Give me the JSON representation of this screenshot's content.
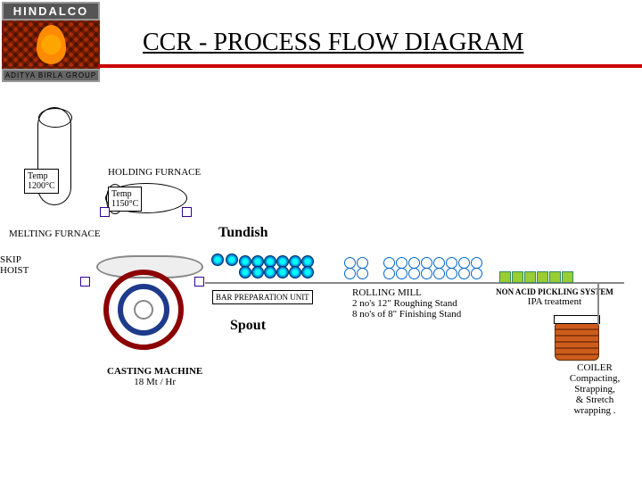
{
  "logo": {
    "brand": "HINDALCO",
    "group": "ADITYA BIRLA GROUP"
  },
  "title": "CCR - PROCESS FLOW DIAGRAM",
  "mf": {
    "label": "MELTING FURNACE",
    "temp_label": "Temp\n1200°C"
  },
  "hf": {
    "label": "HOLDING FURNACE",
    "temp_label": "Temp\n1150°C"
  },
  "tundish": "Tundish",
  "skiphoist": "SKIP\nHOIST",
  "bar_prep": "BAR PREPARATION UNIT",
  "spout": "Spout",
  "casting": {
    "label": "CASTING MACHINE",
    "rate": "18 Mt / Hr"
  },
  "rolling": {
    "title": "ROLLING MILL",
    "l1": "2 no's 12\" Roughing Stand",
    "l2": "8 no's of 8\" Finishing Stand"
  },
  "pickling": {
    "title": "NON ACID PICKLING SYSTEM",
    "sub": "IPA treatment"
  },
  "coiler": {
    "title": "COILER",
    "l1": "Compacting,",
    "l2": "Strapping,",
    "l3": "& Stretch",
    "l4": "wrapping ."
  }
}
